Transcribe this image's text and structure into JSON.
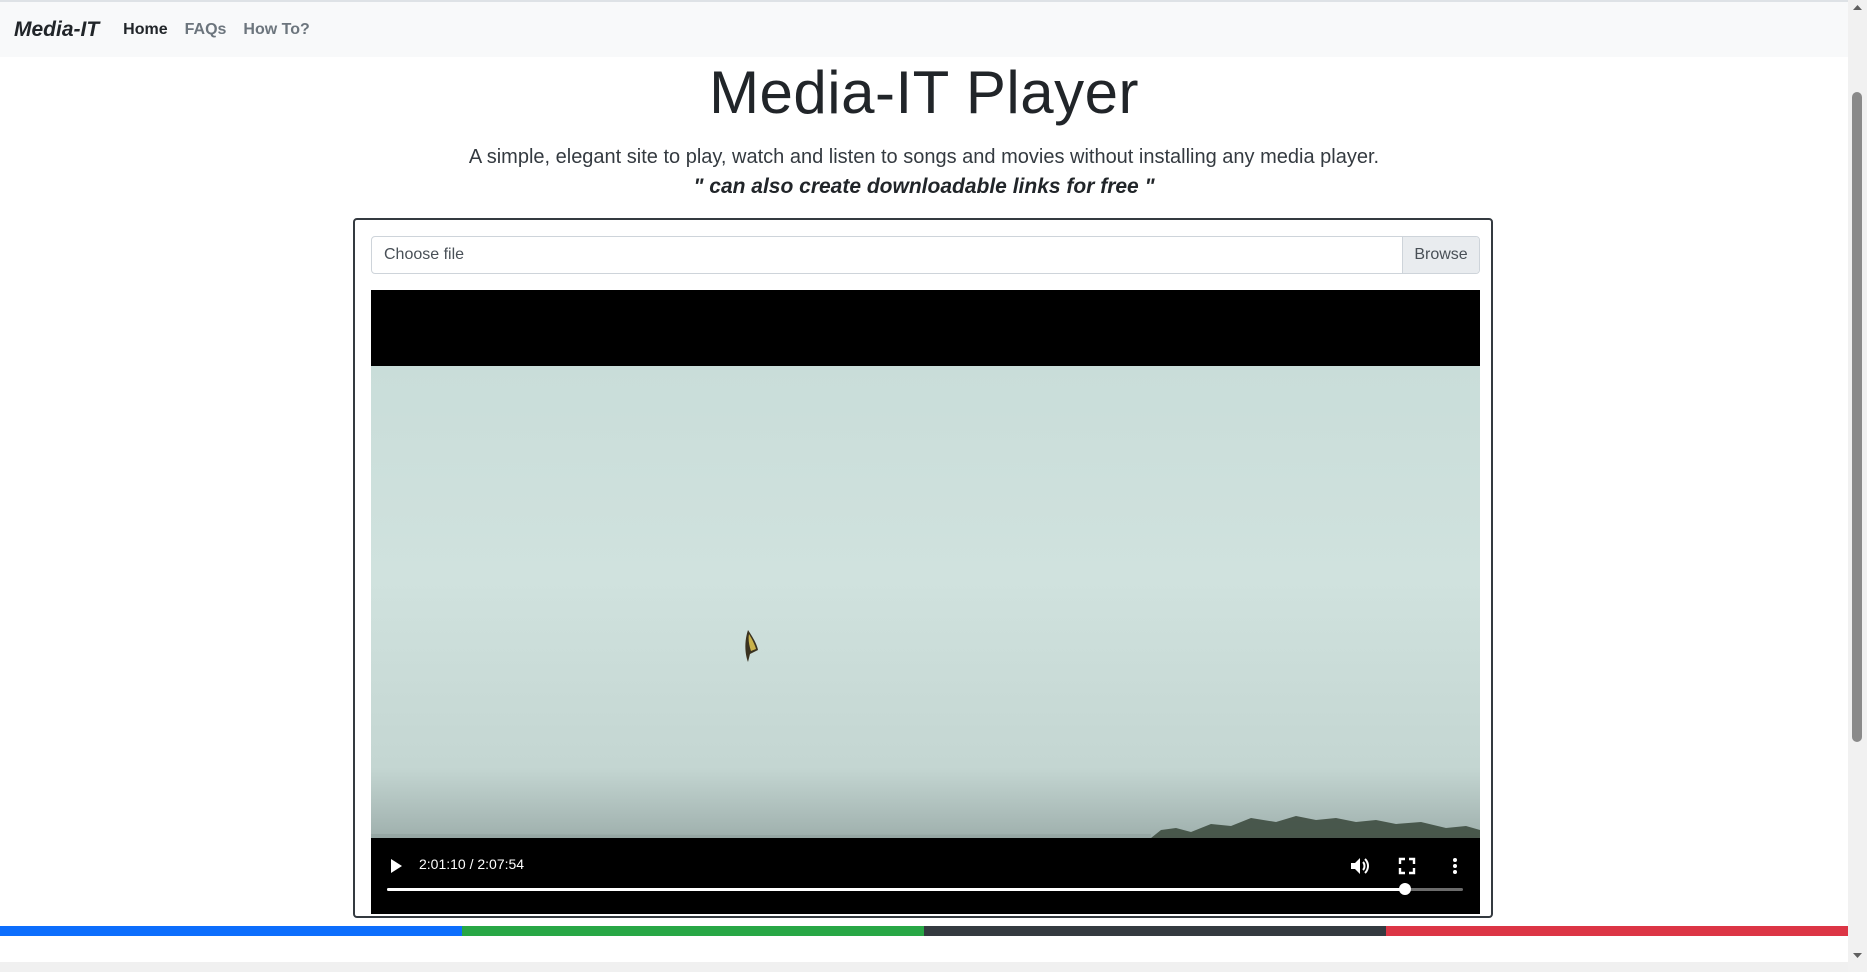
{
  "navbar": {
    "brand": "Media-IT",
    "links": [
      {
        "label": "Home",
        "active": true
      },
      {
        "label": "FAQs",
        "active": false
      },
      {
        "label": "How To?",
        "active": false
      }
    ]
  },
  "hero": {
    "title": "Media-IT Player",
    "subtitle": "A simple, elegant site to play, watch and listen to songs and movies without installing any media player.",
    "tagline": "\" can also create downloadable links for free \""
  },
  "file_input": {
    "placeholder": "Choose file",
    "button_label": "Browse"
  },
  "video": {
    "time_display": "2:01:10 / 2:07:54",
    "progress_fraction": 0.946,
    "icons": [
      "play-icon",
      "volume-icon",
      "fullscreen-icon",
      "more-options-icon"
    ]
  },
  "colors": {
    "accent_bar": [
      "#0d6efd",
      "#28a745",
      "#343a40",
      "#dc3545"
    ]
  }
}
